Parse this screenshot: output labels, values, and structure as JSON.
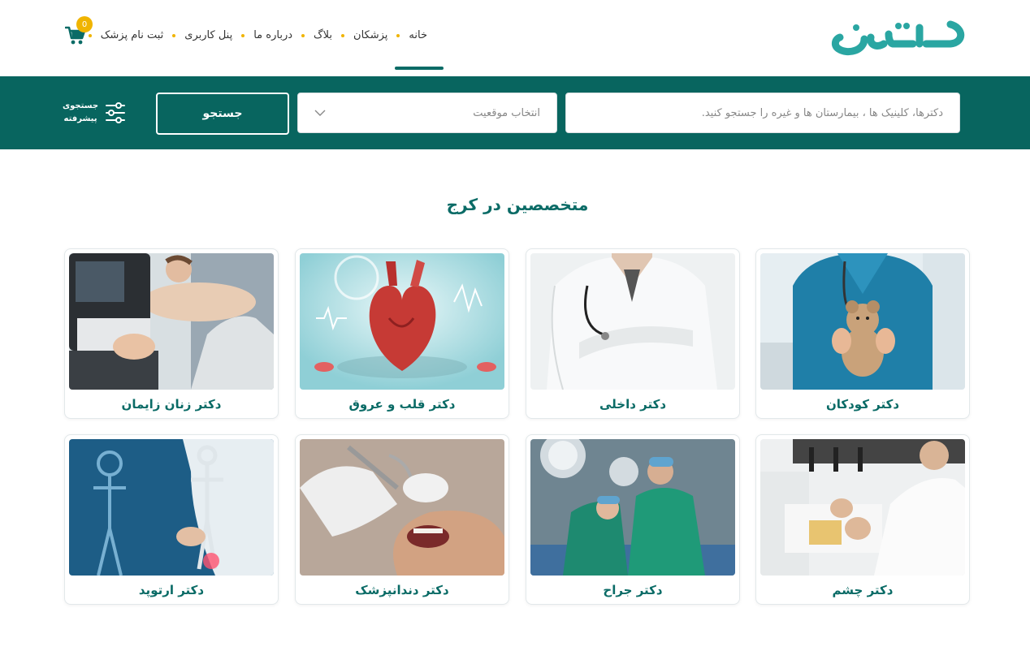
{
  "header": {
    "logo_text": "دکترمن",
    "nav": [
      {
        "label": "خانه",
        "active": true
      },
      {
        "label": "پزشکان"
      },
      {
        "label": "بلاگ"
      },
      {
        "label": "درباره ما"
      },
      {
        "label": "پنل کاربری"
      },
      {
        "label": "ثبت نام پزشک"
      }
    ],
    "cart_count": "0"
  },
  "search": {
    "input_placeholder": "دکترها، کلینیک ها ، بیمارستان ها و غیره را جستجو کنید.",
    "location_placeholder": "انتخاب موقعیت",
    "button_label": "جستجو",
    "advanced_label_line1": "جستجوی",
    "advanced_label_line2": "پیشرفته"
  },
  "section": {
    "title": "متخصصین در کرج"
  },
  "specialties": [
    {
      "label": "دکتر کودکان",
      "icon": "pediatric-doctor-photo"
    },
    {
      "label": "دکتر داخلی",
      "icon": "internal-doctor-photo"
    },
    {
      "label": "دکتر قلب و عروق",
      "icon": "heart-photo"
    },
    {
      "label": "دکتر زنان زایمان",
      "icon": "ultrasound-photo"
    },
    {
      "label": "دکتر چشم",
      "icon": "eye-doctor-photo"
    },
    {
      "label": "دکتر جراح",
      "icon": "surgery-photo"
    },
    {
      "label": "دکتر دندانپزشک",
      "icon": "dentist-photo"
    },
    {
      "label": "دکتر ارتوپد",
      "icon": "skeleton-photo"
    }
  ],
  "colors": {
    "brand": "#08655f",
    "brand_light": "#2aa6a2",
    "accent": "#f0b400"
  }
}
